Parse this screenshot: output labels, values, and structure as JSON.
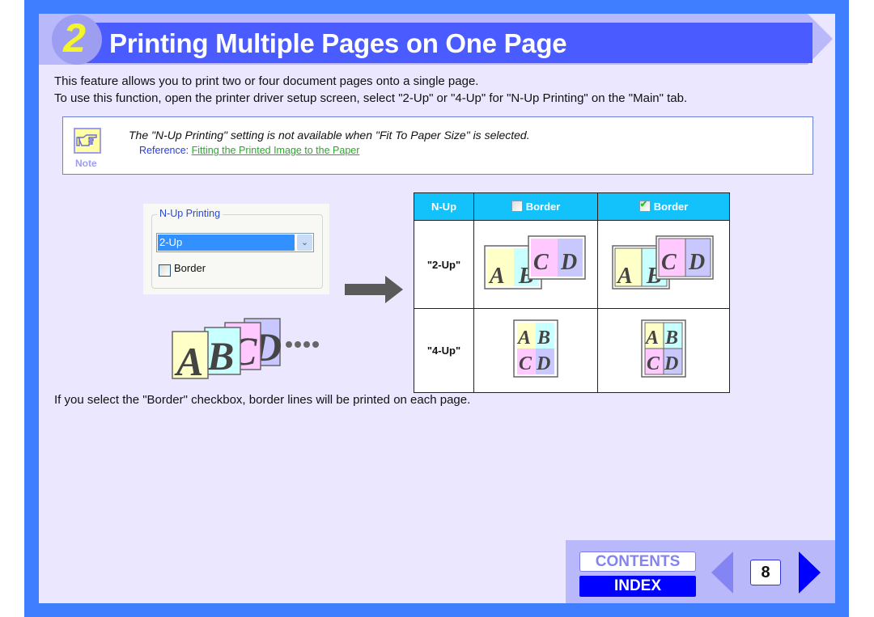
{
  "header": {
    "section_number": "2",
    "title": "Printing Multiple Pages on One Page"
  },
  "intro": {
    "line1": "This feature allows you to print two or four document pages onto a single page.",
    "line2": "To use this function, open the printer driver setup screen, select \"2-Up\" or \"4-Up\" for \"N-Up Printing\" on the \"Main\" tab."
  },
  "note": {
    "icon": "pointing-hand-icon",
    "label": "Note",
    "text": "The \"N-Up Printing\" setting is not available when \"Fit To Paper Size\" is selected.",
    "reference_prefix": "Reference: ",
    "reference_link": "Fitting the Printed Image to the Paper"
  },
  "dialog": {
    "group_label": "N-Up Printing",
    "select_value": "2-Up",
    "checkbox_label": "Border",
    "checkbox_checked": false
  },
  "illustration": {
    "pages": [
      "A",
      "B",
      "C",
      "D"
    ],
    "ellipsis": "••••",
    "page_colors": [
      "#ffffc8",
      "#c8ffff",
      "#ffc8ff",
      "#c8c8ff"
    ]
  },
  "table": {
    "headers": [
      "N-Up",
      "Border",
      "Border"
    ],
    "header_checkboxes": [
      false,
      true
    ],
    "rows": [
      {
        "label": "\"2-Up\"",
        "letters": [
          "A",
          "B",
          "C",
          "D"
        ]
      },
      {
        "label": "\"4-Up\"",
        "letters": [
          "A",
          "B",
          "C",
          "D"
        ]
      }
    ]
  },
  "outro": "If you select the \"Border\" checkbox, border lines will be printed on each page.",
  "nav": {
    "contents": "CONTENTS",
    "index": "INDEX",
    "page": "8"
  },
  "colors": {
    "frame": "#3f7fff",
    "title_bar": "#4a5bff",
    "table_header": "#13c2fa",
    "link": "#2ea52e"
  }
}
